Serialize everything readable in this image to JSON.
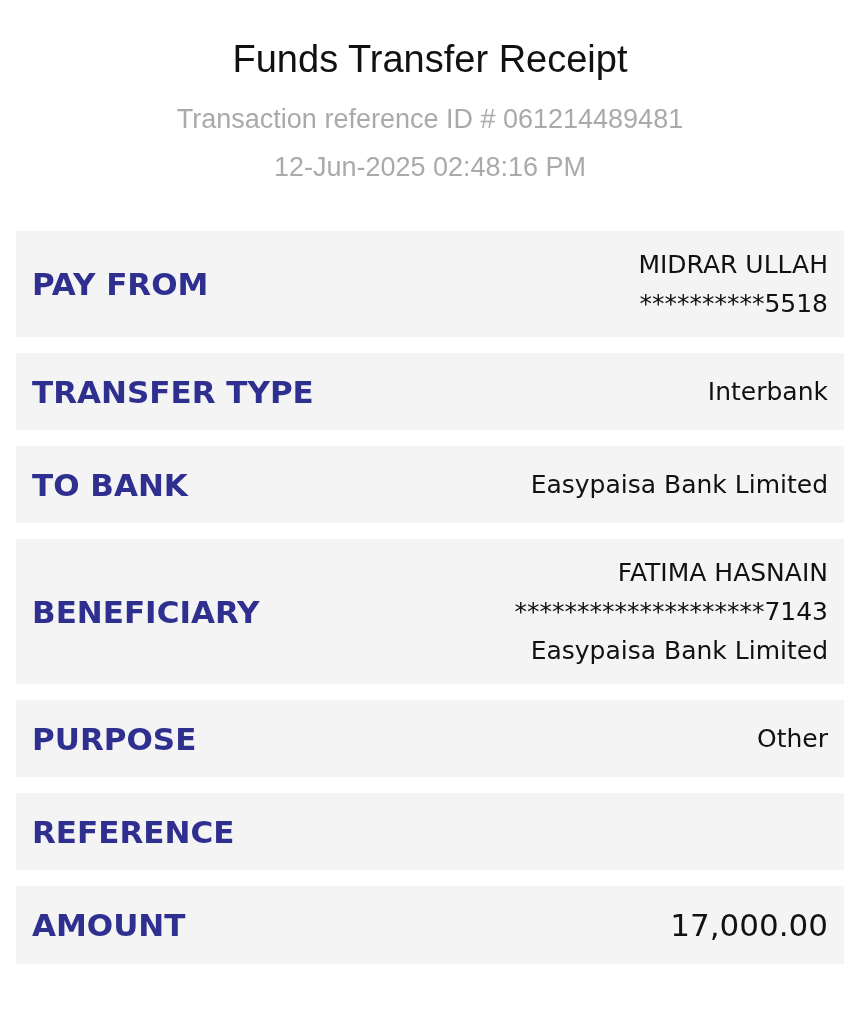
{
  "title": "Funds Transfer Receipt",
  "reference_line": "Transaction reference ID # 061214489481",
  "timestamp": "12-Jun-2025 02:48:16 PM",
  "rows": [
    {
      "kind": "detail",
      "label": "PAY FROM",
      "values": [
        "MIDRAR ULLAH",
        "**********5518"
      ]
    },
    {
      "kind": "detail",
      "label": "TRANSFER TYPE",
      "values": [
        "Interbank"
      ]
    },
    {
      "kind": "detail",
      "label": "TO BANK",
      "values": [
        "Easypaisa Bank Limited"
      ]
    },
    {
      "kind": "detail",
      "label": "BENEFICIARY",
      "values": [
        "FATIMA HASNAIN",
        "********************7143",
        "Easypaisa Bank Limited"
      ]
    },
    {
      "kind": "detail",
      "label": "PURPOSE",
      "values": [
        "Other"
      ]
    },
    {
      "kind": "detail",
      "label": "REFERENCE"
    },
    {
      "kind": "amount",
      "label": "AMOUNT",
      "values": [
        "17,000.00"
      ]
    }
  ]
}
